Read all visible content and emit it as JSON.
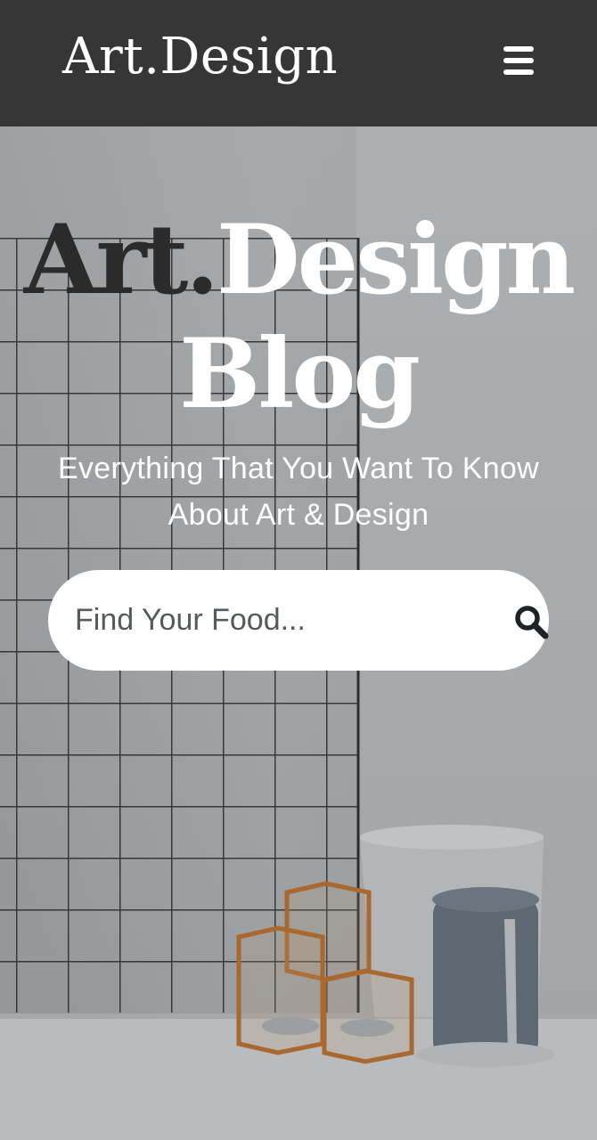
{
  "header": {
    "brand": "Art.Design",
    "menu_icon": "hamburger-menu-icon"
  },
  "hero": {
    "title_part_dark": "Art.",
    "title_part_light": "Design",
    "title_line2": "Blog",
    "subtitle_line1": "Everything That You Want To Know",
    "subtitle_line2": "About Art & Design"
  },
  "search": {
    "placeholder": "Find Your Food...",
    "value": "",
    "icon": "search-icon"
  },
  "colors": {
    "header_bg": "#353635",
    "text_light": "#ffffff",
    "text_dark": "#2b2b2b"
  }
}
